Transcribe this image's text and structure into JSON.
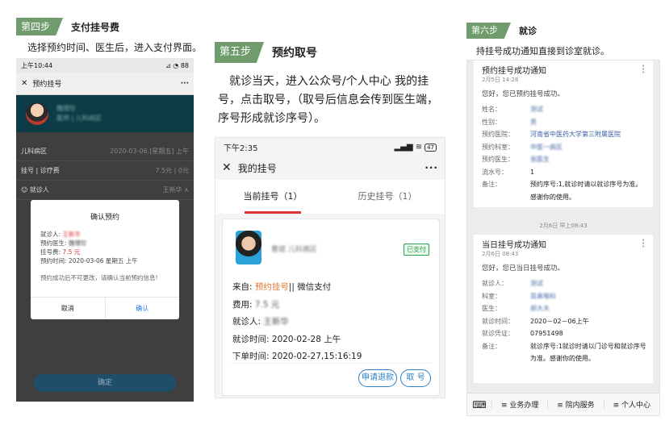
{
  "step4": {
    "tag": "第四步",
    "title": "支付挂号费",
    "desc": "选择预约时间、医生后，进入支付界面。",
    "phone": {
      "status_time": "上午10:44",
      "status_icons": "⊿ ◔ 88",
      "nav_title": "预约挂号",
      "doctor_name": "魏理珍",
      "doctor_dept": "医师 | 儿科病区",
      "rows": [
        {
          "label": "儿科病区",
          "value": "2020-03-06 [星期五] 上午"
        },
        {
          "label": "挂号 | 诊疗费",
          "value": "7.5元 | 0元"
        },
        {
          "label": "就诊人",
          "value": "王新华 ∧"
        }
      ],
      "bottom_btn": "确定",
      "modal": {
        "title": "确认预约",
        "patient_label": "就诊人:",
        "patient_value": "王新华",
        "doctor_label": "预约医生:",
        "doctor_value": "魏理珍",
        "fee_label": "挂号费:",
        "fee_value": "7.5 元",
        "time_label": "预约时间:",
        "time_value": "2020-03-06 星期五 上午",
        "note": "预约成功后不可更改，请确认当前预约信息!",
        "cancel": "取消",
        "confirm": "确认"
      }
    }
  },
  "step5": {
    "tag": "第五步",
    "title": "预约取号",
    "desc": "就诊当天，进入公众号/个人中心 我的挂号，点击取号，（取号后信息会传到医生端，序号形成就诊序号）。",
    "phone": {
      "status_time": "下午2:35",
      "status_icons": "▂▄▆ ≋",
      "battery": "47",
      "nav_title": "我的挂号",
      "tabs": [
        "当前挂号（1）",
        "历史挂号（1）"
      ],
      "card": {
        "name": "曹斌 儿科病区",
        "paid": "已支付",
        "from_label": "来自: ",
        "from_value": "预约挂号",
        "from_suffix": "|| 微信支付",
        "fee_label": "费用: ",
        "fee_value": "7.5 元",
        "patient_label": "就诊人: ",
        "patient_value": "王新华",
        "visit_label": "就诊时间: ",
        "visit_value": "2020-02-28 上午",
        "order_label": "下单时间: ",
        "order_value": "2020-02-27,15:16:19",
        "refund_btn": "申请退款",
        "take_btn": "取 号"
      }
    }
  },
  "step6": {
    "tag": "第六步",
    "title": "就诊",
    "desc": "持挂号成功通知直接到诊室就诊。",
    "phone": {
      "msg1": {
        "title": "预约挂号成功通知",
        "date": "2月5日 14:28",
        "greet": "您好，您已预约挂号成功。",
        "rows": [
          {
            "k": "姓名：",
            "v": "测试",
            "style": "blur"
          },
          {
            "k": "性别：",
            "v": "男",
            "style": "blur"
          },
          {
            "k": "预约医院：",
            "v": "河南省中医药大学第三附属医院",
            "style": "blue"
          },
          {
            "k": "预约科室：",
            "v": "中医一病区",
            "style": "blur"
          },
          {
            "k": "预约医生：",
            "v": "张医生",
            "style": "blur"
          },
          {
            "k": "流水号：",
            "v": "1",
            "style": "plain"
          },
          {
            "k": "备注：",
            "v": "预约序号:1,就诊时请以就诊序号为准。感谢你的使用。",
            "style": "plain"
          }
        ]
      },
      "stamp": "2月6日 早上08:43",
      "msg2": {
        "title": "当日挂号成功通知",
        "date": "2月6日 08:43",
        "greet": "您好，您已当日挂号成功。",
        "rows": [
          {
            "k": "就诊人：",
            "v": "测试",
            "style": "blur"
          },
          {
            "k": "科室：",
            "v": "耳鼻喉科",
            "style": "blur"
          },
          {
            "k": "医生：",
            "v": "郝大夫",
            "style": "blur"
          },
          {
            "k": "就诊时间：",
            "v": "2020－02－06上午",
            "style": "plain"
          },
          {
            "k": "就诊凭证：",
            "v": "07951498",
            "style": "plain"
          },
          {
            "k": "备注：",
            "v": "就诊序号:1就诊时请以门诊号和就诊序号为准。感谢你的使用。",
            "style": "plain"
          }
        ]
      },
      "bottom": [
        "≡ 业务办理",
        "≡ 院内服务",
        "≡ 个人中心"
      ]
    }
  }
}
